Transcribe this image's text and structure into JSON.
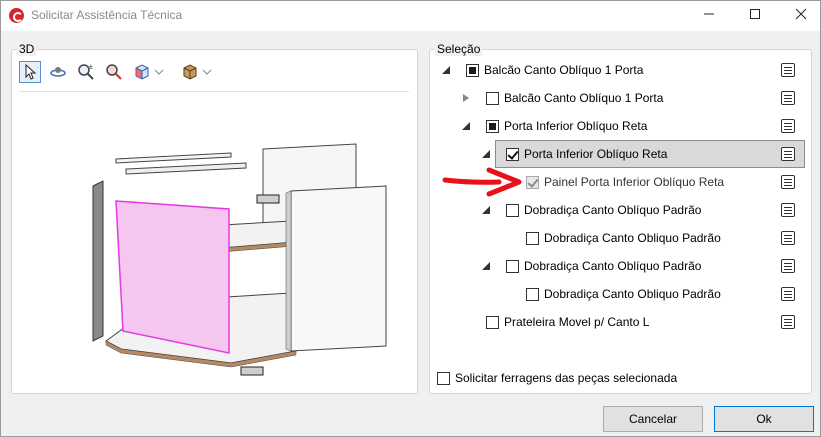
{
  "window": {
    "title": "Solicitar Assistência Técnica"
  },
  "panel3d": {
    "label": "3D"
  },
  "selection": {
    "label": "Seleção",
    "items": [
      {
        "label": "Balcão Canto Oblíquo 1 Porta"
      },
      {
        "label": "Balcão Canto Oblíquo 1 Porta"
      },
      {
        "label": "Porta Inferior Oblíquo Reta"
      },
      {
        "label": "Porta Inferior Oblíquo Reta"
      },
      {
        "label": "Painel Porta Inferior Oblíquo Reta"
      },
      {
        "label": "Dobradiça Canto Oblíquo Padrão"
      },
      {
        "label": "Dobradiça Canto Obliquo Padrão"
      },
      {
        "label": "Dobradiça Canto Oblíquo Padrão"
      },
      {
        "label": "Dobradiça Canto Obliquo Padrão"
      },
      {
        "label": "Prateleira Movel p/ Canto L"
      }
    ]
  },
  "footer": {
    "hardware_checkbox": "Solicitar ferragens das peças selecionada",
    "cancel_label": "Cancelar",
    "ok_label": "Ok"
  },
  "colors": {
    "highlight_panel": "#f5c6f0",
    "highlight_edge": "#e33be0",
    "annotation_arrow": "#e8111a"
  }
}
